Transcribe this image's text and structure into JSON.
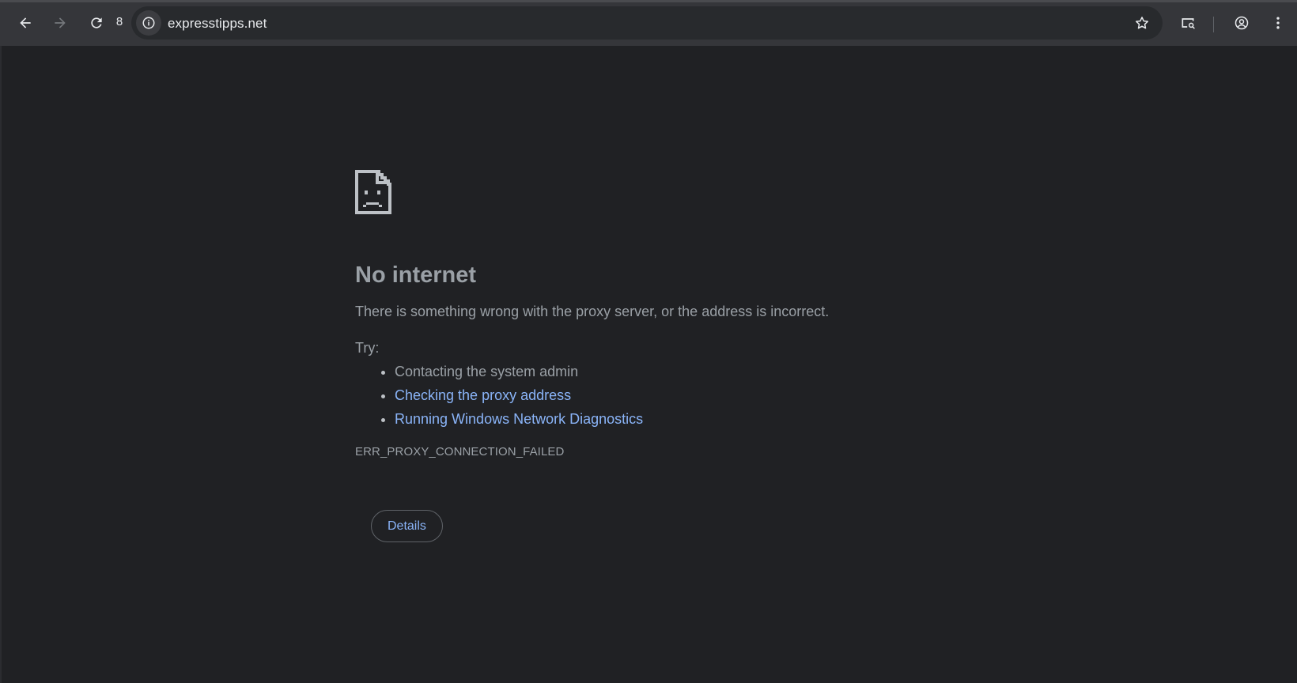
{
  "browser": {
    "reload_count": "8",
    "url": "expresstipps.net",
    "icons": {
      "back": "arrow-left-icon",
      "forward": "arrow-right-icon",
      "reload": "reload-icon",
      "site_info": "info-icon",
      "bookmark": "star-icon",
      "lens": "search-page-icon",
      "profile": "account-circle-icon",
      "menu": "more-vert-icon"
    }
  },
  "error_page": {
    "icon": "sad-page-icon",
    "title": "No internet",
    "summary": "There is something wrong with the proxy server, or the address is incorrect.",
    "try_label": "Try:",
    "suggestions": [
      {
        "text": "Contacting the system admin",
        "is_link": false
      },
      {
        "text": "Checking the proxy address",
        "is_link": true
      },
      {
        "text": "Running Windows Network Diagnostics",
        "is_link": true
      }
    ],
    "error_code": "ERR_PROXY_CONNECTION_FAILED",
    "details_button": "Details"
  },
  "colors": {
    "page_background": "#202124",
    "toolbar_background": "#35363a",
    "text_secondary": "#9aa0a6",
    "link": "#8ab4f8"
  }
}
